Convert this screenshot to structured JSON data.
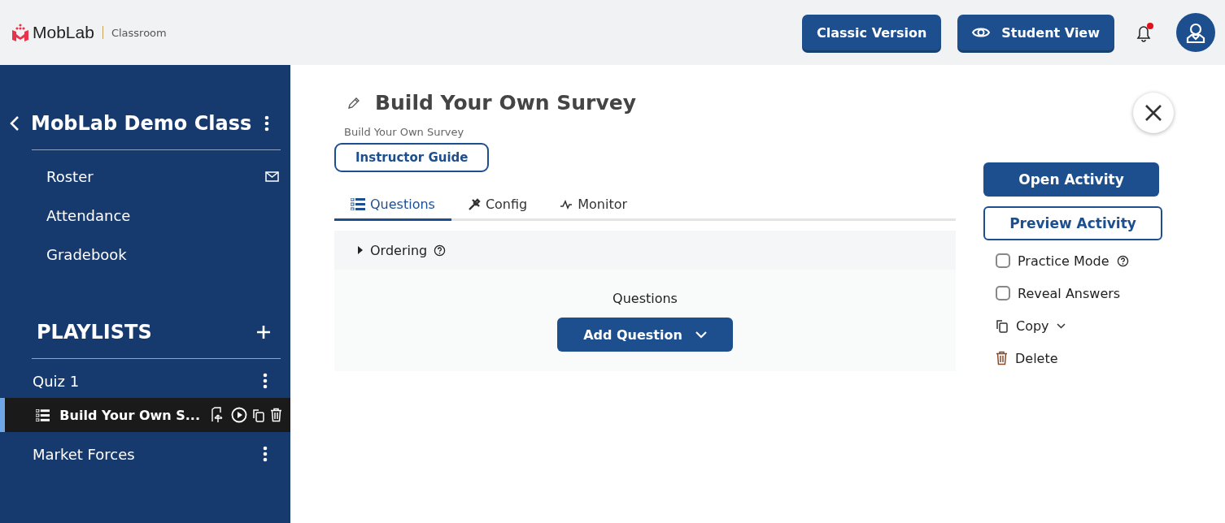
{
  "header": {
    "logo": "MobLab",
    "product": "Classroom",
    "buttons": [
      {
        "kind": "classic",
        "label": "Classic Version"
      },
      {
        "kind": "student",
        "label": "Student View"
      }
    ]
  },
  "sidebar": {
    "class_name": "MobLab Demo Class",
    "nav": [
      {
        "kind": "mail",
        "label": "Roster"
      },
      {
        "kind": "plain",
        "label": "Attendance"
      },
      {
        "kind": "plain",
        "label": "Gradebook"
      }
    ],
    "playlists_heading": "PLAYLISTS",
    "playlists": [
      {
        "kind": "playlist",
        "label": "Quiz 1",
        "selected": false
      },
      {
        "kind": "activity",
        "label": "Build Your Own S...",
        "selected": true
      },
      {
        "kind": "playlist",
        "label": "Market Forces",
        "selected": false
      }
    ]
  },
  "main": {
    "title": "Build Your Own Survey",
    "subtitle": "Build Your Own Survey",
    "guide_button": "Instructor Guide",
    "tabs": [
      {
        "kind": "questions",
        "label": "Questions",
        "selected": true
      },
      {
        "kind": "config",
        "label": "Config",
        "selected": false
      },
      {
        "kind": "monitor",
        "label": "Monitor",
        "selected": false
      }
    ],
    "ordering": {
      "label": "Ordering",
      "expanded": false
    },
    "questions_heading": "Questions",
    "add_button": "Add Question"
  },
  "actions": {
    "open": "Open Activity",
    "preview": "Preview Activity",
    "options": [
      {
        "kind": "checkbox",
        "label": "Practice Mode",
        "checked": false,
        "help": true
      },
      {
        "kind": "checkbox",
        "label": "Reveal Answers",
        "checked": false,
        "help": false
      },
      {
        "kind": "copy",
        "label": "Copy"
      },
      {
        "kind": "delete",
        "label": "Delete"
      }
    ]
  }
}
